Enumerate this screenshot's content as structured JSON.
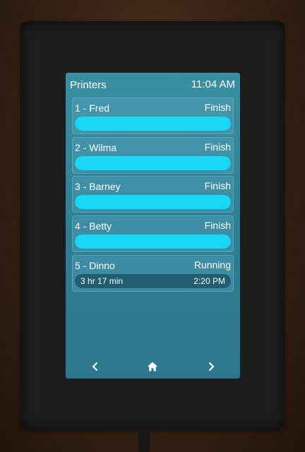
{
  "header": {
    "title": "Printers",
    "time": "11:04 AM"
  },
  "printers": [
    {
      "name": "1 - Fred",
      "status": "Finish",
      "progress": 1.0,
      "elapsed": "",
      "eta": ""
    },
    {
      "name": "2 - Wilma",
      "status": "Finish",
      "progress": 1.0,
      "elapsed": "",
      "eta": ""
    },
    {
      "name": "3 - Barney",
      "status": "Finish",
      "progress": 1.0,
      "elapsed": "",
      "eta": ""
    },
    {
      "name": "4 - Betty",
      "status": "Finish",
      "progress": 1.0,
      "elapsed": "",
      "eta": ""
    },
    {
      "name": "5 - Dinno",
      "status": "Running",
      "progress": 0.0,
      "elapsed": "3 hr 17 min",
      "eta": "2:20 PM"
    }
  ],
  "nav": {
    "prev_icon": "chevron-left-icon",
    "home_icon": "home-icon",
    "next_icon": "chevron-right-icon"
  },
  "colors": {
    "progress_fill": "#1ad8f5",
    "screen_background": "#2f7f94",
    "text": "#ffffff"
  }
}
